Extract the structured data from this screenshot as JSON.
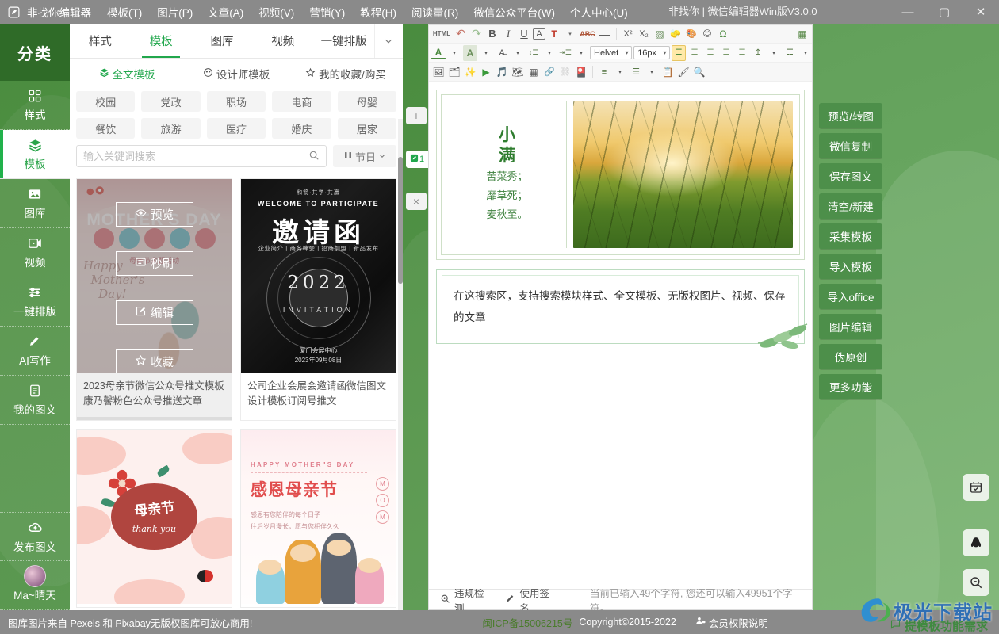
{
  "titlebar": {
    "logo_icon": "edit-square-icon",
    "app_name": "非找你编辑器",
    "menus": [
      "模板(T)",
      "图片(P)",
      "文章(A)",
      "视频(V)",
      "营销(Y)",
      "教程(H)",
      "阅读量(R)",
      "微信公众平台(W)",
      "个人中心(U)"
    ],
    "window_title": "非找你 | 微信编辑器Win版V3.0.0",
    "minimize": "—",
    "maximize": "▢",
    "close": "✕"
  },
  "rail": {
    "header": "分类",
    "items": [
      {
        "label": "样式",
        "icon": "grid-icon",
        "active": false
      },
      {
        "label": "模板",
        "icon": "layers-icon",
        "active": true
      },
      {
        "label": "图库",
        "icon": "image-icon",
        "active": false
      },
      {
        "label": "视频",
        "icon": "video-icon",
        "active": false
      },
      {
        "label": "一键排版",
        "icon": "sliders-icon",
        "active": false
      },
      {
        "label": "AI写作",
        "icon": "pencil-icon",
        "active": false
      },
      {
        "label": "我的图文",
        "icon": "document-icon",
        "active": false
      }
    ],
    "publish": {
      "label": "发布图文",
      "icon": "cloud-upload-icon"
    },
    "user": {
      "label": "Ma~晴天",
      "icon": "avatar"
    }
  },
  "midpanel": {
    "tabs": [
      {
        "label": "样式",
        "active": false
      },
      {
        "label": "模板",
        "active": true
      },
      {
        "label": "图库",
        "active": false
      },
      {
        "label": "视频",
        "active": false
      },
      {
        "label": "一键排版",
        "active": false
      }
    ],
    "tabs_more_icon": "chevron-down-icon",
    "subtabs": [
      {
        "label": "全文模板",
        "icon": "layers-icon",
        "active": true
      },
      {
        "label": "设计师模板",
        "icon": "palette-icon",
        "active": false
      },
      {
        "label": "我的收藏/购买",
        "icon": "star-icon",
        "active": false
      }
    ],
    "chips_row1": [
      "校园",
      "党政",
      "职场",
      "电商",
      "母婴"
    ],
    "chips_row2": [
      "餐饮",
      "旅游",
      "医疗",
      "婚庆",
      "居家"
    ],
    "search": {
      "placeholder": "输入关键词搜索",
      "value": "",
      "icon": "search-icon"
    },
    "holiday_filter": {
      "label": "节日",
      "icon": "filter-icon",
      "arrow": "chevron-down-icon"
    },
    "card_overlay_actions": [
      {
        "label": "预览",
        "icon": "eye-icon"
      },
      {
        "label": "秒刷",
        "icon": "list-icon"
      },
      {
        "label": "编辑",
        "icon": "edit-icon"
      },
      {
        "label": "收藏",
        "icon": "star-icon"
      }
    ],
    "cards": [
      {
        "caption": "2023母亲节微信公众号推文模板康乃馨粉色公众号推送文章",
        "art": "mothers-day-pink",
        "selected": true,
        "art_text": {
          "title": "MOTHER'S DAY",
          "chips": [
            "感",
            "恩",
            "母",
            "亲",
            "节"
          ],
          "sub": "母亲节主题活动"
        }
      },
      {
        "caption": "公司企业会展会邀请函微信图文设计模板订阅号推文",
        "art": "black-invitation",
        "selected": false,
        "art_text": {
          "line1": "和箭·共学·共赢",
          "line2": "WELCOME TO PARTICIPATE",
          "big": "邀请函",
          "line3": "企业简介丨商务峰会丨招商加盟丨新品发布",
          "year": "2022",
          "invitation": "INVITATION",
          "foot1": "厦门会展中心",
          "foot2": "2023年09月08日"
        }
      },
      {
        "caption": "",
        "art": "mothers-day-flower",
        "selected": false,
        "art_text": {
          "title": "母亲节",
          "sub": "thank you"
        }
      },
      {
        "caption": "",
        "art": "happy-mothers-day",
        "selected": false,
        "art_text": {
          "en": "HAPPY MOTHER\"S DAY",
          "cn": "感恩母亲节",
          "p1": "感恩有您陪伴的每个日子",
          "p2": "往后岁月漫长，愿与您相伴久久",
          "badge": [
            "M",
            "O",
            "M"
          ]
        }
      }
    ]
  },
  "splitter": {
    "add_icon": "plus-icon",
    "close_icon": "close-icon",
    "tab_label": "1",
    "tab_icon": "edit-square-icon"
  },
  "editor": {
    "toolbar_row1": [
      {
        "name": "html-source-button",
        "glyph": "HTML",
        "type": "text"
      },
      {
        "name": "undo-button",
        "glyph": "↶"
      },
      {
        "name": "redo-button",
        "glyph": "↷"
      },
      {
        "name": "bold-button",
        "glyph": "B"
      },
      {
        "name": "italic-button",
        "glyph": "I"
      },
      {
        "name": "underline-button",
        "glyph": "U"
      },
      {
        "name": "font-box-button",
        "glyph": "A"
      },
      {
        "name": "text-format-button",
        "glyph": "T"
      },
      {
        "name": "text-format-arrow",
        "glyph": "▾"
      },
      {
        "name": "strikethrough-button",
        "glyph": "ABC"
      },
      {
        "name": "horizontal-rule-button",
        "glyph": "—"
      },
      {
        "name": "superscript-button",
        "glyph": "X²"
      },
      {
        "name": "subscript-button",
        "glyph": "X₂"
      },
      {
        "name": "pattern-button",
        "glyph": "▨"
      },
      {
        "name": "eraser-button",
        "glyph": "🧽"
      },
      {
        "name": "palette-button",
        "glyph": "🎨"
      },
      {
        "name": "emoji-button",
        "glyph": "😊"
      },
      {
        "name": "special-char-button",
        "glyph": "Ω"
      },
      {
        "name": "table-grid-button",
        "glyph": "▦"
      }
    ],
    "toolbar_row2": [
      {
        "name": "font-color-button",
        "glyph": "A"
      },
      {
        "name": "font-color-arrow",
        "glyph": "▾"
      },
      {
        "name": "highlight-color-button",
        "glyph": "A"
      },
      {
        "name": "highlight-color-arrow",
        "glyph": "▾"
      },
      {
        "name": "clear-format-button",
        "glyph": "A̶"
      },
      {
        "name": "clear-format-arrow",
        "glyph": "▾"
      },
      {
        "name": "line-height-button",
        "glyph": "↕☰"
      },
      {
        "name": "line-height-arrow",
        "glyph": "▾"
      },
      {
        "name": "indent-button",
        "glyph": "⇥☰"
      },
      {
        "name": "indent-arrow",
        "glyph": "▾"
      },
      {
        "name": "align-left-button",
        "glyph": "☰"
      },
      {
        "name": "align-center-button",
        "glyph": "☰"
      },
      {
        "name": "align-right-button",
        "glyph": "☰"
      },
      {
        "name": "align-justify-button",
        "glyph": "☰"
      },
      {
        "name": "align-distribute-button",
        "glyph": "☰"
      },
      {
        "name": "vertical-align-button",
        "glyph": "↥"
      },
      {
        "name": "vertical-align-arrow",
        "glyph": "▾"
      },
      {
        "name": "paragraph-spacing-button",
        "glyph": "☴"
      },
      {
        "name": "paragraph-spacing-arrow",
        "glyph": "▾"
      }
    ],
    "font_family": "Helvet",
    "font_size": "16px",
    "toolbar_row3": [
      {
        "name": "insert-image-button",
        "glyph": "🖼"
      },
      {
        "name": "insert-multi-image-button",
        "glyph": "🗂"
      },
      {
        "name": "magic-wand-button",
        "glyph": "✨"
      },
      {
        "name": "insert-video-button",
        "glyph": "▶"
      },
      {
        "name": "insert-audio-button",
        "glyph": "🎵"
      },
      {
        "name": "insert-map-button",
        "glyph": "🗺"
      },
      {
        "name": "insert-table-button",
        "glyph": "▦"
      },
      {
        "name": "insert-link-button",
        "glyph": "🔗"
      },
      {
        "name": "unlink-button",
        "glyph": "⛓"
      },
      {
        "name": "insert-card-button",
        "glyph": "🎴"
      },
      {
        "name": "ordered-list-button",
        "glyph": "≡"
      },
      {
        "name": "ordered-list-arrow",
        "glyph": "▾"
      },
      {
        "name": "unordered-list-button",
        "glyph": "☰"
      },
      {
        "name": "unordered-list-arrow",
        "glyph": "▾"
      },
      {
        "name": "paste-button",
        "glyph": "📋"
      },
      {
        "name": "format-painter-button",
        "glyph": "🖌"
      },
      {
        "name": "find-button",
        "glyph": "🔍"
      }
    ],
    "content": {
      "block1": {
        "title_char1": "小",
        "title_char2": "满",
        "lines": [
          "苦菜秀；",
          "靡草死；",
          "麦秋至。"
        ],
        "image_alt": "sunset-wheat-field"
      },
      "block2": {
        "text": "在这搜索区，支持搜索模块样式、全文模板、无版权图片、视频、保存的文章",
        "decoration": "leaf-branch"
      }
    },
    "status": {
      "check_label": "违规检测",
      "check_icon": "magnifier-plus-icon",
      "signature_label": "使用签名",
      "signature_icon": "pencil-icon",
      "count_text": "当前已输入49个字符, 您还可以输入49951个字符。"
    }
  },
  "rightpanel": {
    "buttons": [
      "预览/转图",
      "微信复制",
      "保存图文",
      "清空/新建",
      "采集模板",
      "导入模板",
      "导入office",
      "图片编辑",
      "伪原创",
      "更多功能"
    ],
    "floats": [
      {
        "name": "calendar-icon",
        "glyph": "📅"
      },
      {
        "name": "qq-icon",
        "glyph": "🐧"
      },
      {
        "name": "zoom-out-icon",
        "glyph": "🔍"
      }
    ]
  },
  "footer": {
    "left": "图库图片来自 Pexels 和 Pixabay无版权图库可放心商用!",
    "icp": "闽ICP备15006215号",
    "copyright": "Copyright©2015-2022",
    "member": "会员权限说明",
    "member_icon": "user-badge-icon"
  },
  "watermark": {
    "text": "极光下载站",
    "sub": "提模板功能需求",
    "sub_icon": "chat-icon"
  },
  "colors": {
    "brand_green": "#21a74c",
    "rail_green": "#4f9043",
    "rail_head_green": "#2f6b28",
    "right_panel_green": "#6aa862",
    "button_green": "#4d8f4a",
    "titlebar_gray": "#8a8a8a"
  }
}
